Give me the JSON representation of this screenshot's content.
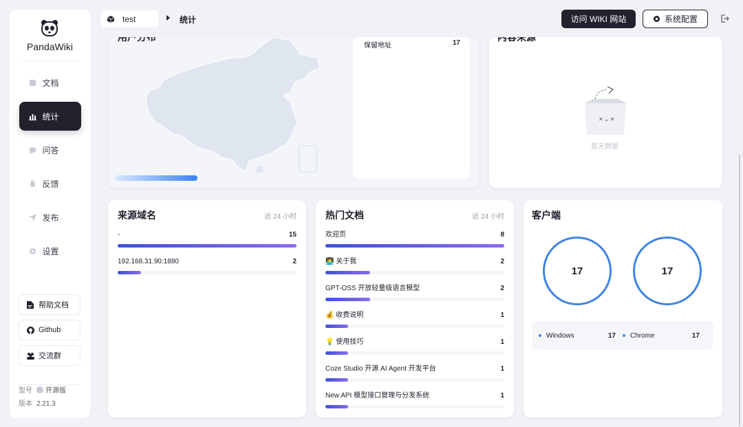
{
  "app": {
    "name": "PandaWiki"
  },
  "sidebar": {
    "items": [
      {
        "label": "文档",
        "icon": "document-icon",
        "active": false
      },
      {
        "label": "统计",
        "icon": "bar-chart-icon",
        "active": true
      },
      {
        "label": "问答",
        "icon": "chat-icon",
        "active": false
      },
      {
        "label": "反馈",
        "icon": "hand-icon",
        "active": false
      },
      {
        "label": "发布",
        "icon": "send-icon",
        "active": false
      },
      {
        "label": "设置",
        "icon": "gear-icon",
        "active": false
      }
    ],
    "buttons": [
      {
        "label": "帮助文档",
        "icon": "doc-icon"
      },
      {
        "label": "Github",
        "icon": "github-icon"
      },
      {
        "label": "交流群",
        "icon": "group-icon"
      }
    ],
    "version": {
      "model_label": "型号",
      "model_value": "开源版",
      "version_label": "版本",
      "version_value": "2.21.3"
    }
  },
  "header": {
    "breadcrumb_root": "test",
    "breadcrumb_current": "统计",
    "visit_wiki": "访问 WIKI 网站",
    "config": "系统配置"
  },
  "map_card": {
    "title": "用户分布",
    "location_label": "保留地址",
    "location_value": "17",
    "colors": {
      "land": "#dfe6f0",
      "bar_end": "#3b82f6"
    }
  },
  "source_card": {
    "title": "内容来源",
    "empty": "暂无数据"
  },
  "domains_card": {
    "title": "来源域名",
    "subtitle": "近 24 小时",
    "rows": [
      {
        "label": "-",
        "value": "15",
        "pct": 100
      },
      {
        "label": "192.168.31.90:1880",
        "value": "2",
        "pct": 13
      }
    ]
  },
  "docs_card": {
    "title": "热门文档",
    "subtitle": "近 24 小时",
    "rows": [
      {
        "label": "欢迎页",
        "value": "8",
        "pct": 100
      },
      {
        "label": "🧑‍💻 关于我",
        "value": "2",
        "pct": 25
      },
      {
        "label": "GPT-OSS 开放轻量级语言模型",
        "value": "2",
        "pct": 25
      },
      {
        "label": "💰 收费说明",
        "value": "1",
        "pct": 12.5
      },
      {
        "label": "💡 使用技巧",
        "value": "1",
        "pct": 12.5
      },
      {
        "label": "Coze Studio 开源 AI Agent 开发平台",
        "value": "1",
        "pct": 12.5
      },
      {
        "label": "New API 模型接口管理与分发系统",
        "value": "1",
        "pct": 12.5
      }
    ]
  },
  "client_card": {
    "title": "客户端",
    "os_total": "17",
    "browser_total": "17",
    "legend": [
      {
        "name": "Windows",
        "value": "17"
      },
      {
        "name": "Chrome",
        "value": "17"
      }
    ],
    "ring_color": "#3f84e5"
  }
}
